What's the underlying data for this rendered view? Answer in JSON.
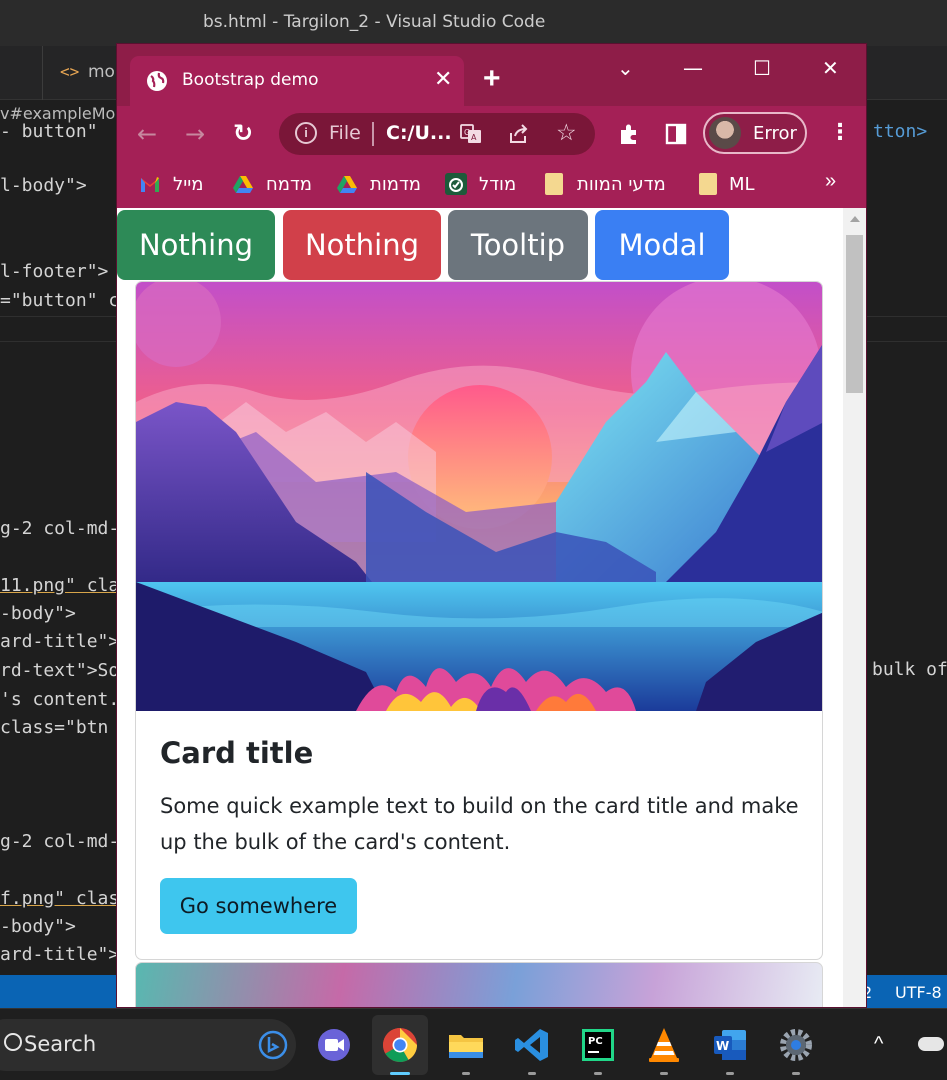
{
  "vscode": {
    "window_title": "bs.html - Targilon_2 - Visual Studio Code",
    "tab_icon": "<>",
    "tab_label": "mo",
    "breadcrumb": "v#exampleMo",
    "status_encoding": "UTF-8",
    "status_number": "2",
    "code_lines": [
      {
        "text": "- button\"",
        "color": "#569cd6"
      },
      {
        "text": "l-body\">",
        "color": "#9cdcfe"
      },
      {
        "text": "l-footer\">",
        "color": "#9cdcfe"
      },
      {
        "text": "=\"button\" c",
        "color": "#ce9178"
      },
      {
        "text": "g-2 col-md-",
        "color": "#ce9178"
      },
      {
        "text": "11.png\" cla",
        "color": "#ce9178"
      },
      {
        "text": "-body\">",
        "color": "#ce9178"
      },
      {
        "text": "ard-title\">",
        "color": "#ce9178"
      },
      {
        "text": "rd-text\">So",
        "color": "#ce9178"
      },
      {
        "text": "'s content.",
        "color": "#d4d4d4"
      },
      {
        "text": "class=\"btn",
        "color": "#9cdcfe"
      },
      {
        "text": "g-2 col-md-",
        "color": "#ce9178"
      },
      {
        "text": "f.png\" clas",
        "color": "#ce9178"
      },
      {
        "text": "-body\">",
        "color": "#ce9178"
      },
      {
        "text": "ard-title\">",
        "color": "#ce9178"
      }
    ],
    "right_overflow_text": "bulk of",
    "right_top_text": "tton>"
  },
  "browser": {
    "tab_title": "Bootstrap demo",
    "close_glyph": "✕",
    "new_tab_glyph": "+",
    "window_controls": {
      "dropdown": "⌄",
      "minimize": "—",
      "maximize": "☐",
      "close": "✕"
    },
    "omnibox": {
      "scheme_label": "File",
      "url": "C:/U..."
    },
    "profile_label": "Error",
    "bookmarks": [
      {
        "label": "מייל",
        "icon": "gmail-icon"
      },
      {
        "label": "מדמח",
        "icon": "google-drive-icon"
      },
      {
        "label": "מדמות",
        "icon": "google-drive-icon"
      },
      {
        "label": "מודל",
        "icon": "moodle-icon"
      },
      {
        "label": "מדעי המוות",
        "icon": "folder-icon"
      },
      {
        "label": "ML",
        "icon": "folder-icon"
      }
    ],
    "bookmarks_more": "»"
  },
  "page": {
    "buttons": [
      {
        "label": "Nothing",
        "color": "#2d8a57"
      },
      {
        "label": "Nothing",
        "color": "#d1404a"
      },
      {
        "label": "Tooltip",
        "color": "#6c757d"
      },
      {
        "label": "Modal",
        "color": "#3a7ff3"
      }
    ],
    "card": {
      "title": "Card title",
      "text": "Some quick example text to build on the card title and make up the bulk of the card's content.",
      "button_label": "Go somewhere"
    }
  },
  "taskbar": {
    "search_label": "Search",
    "apps": [
      "bing-icon",
      "teams-icon",
      "chrome-icon",
      "file-explorer-icon",
      "vscode-icon",
      "pycharm-icon",
      "vlc-icon",
      "word-icon",
      "settings-icon"
    ],
    "tray_arrow": "^"
  }
}
